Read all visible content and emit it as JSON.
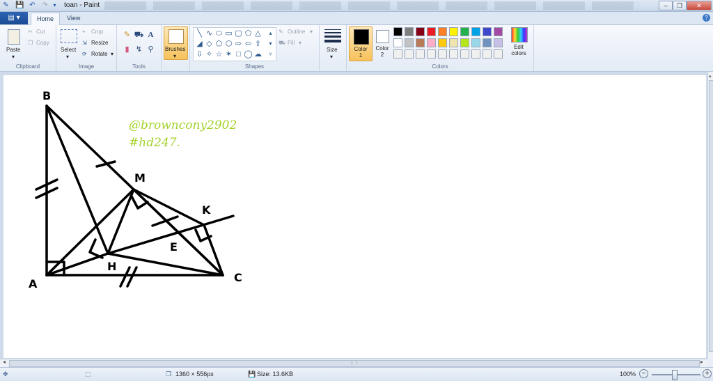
{
  "window": {
    "title": "toan - Paint",
    "minimize_glyph": "–",
    "restore_glyph": "❐",
    "close_glyph": "✕"
  },
  "tabs": {
    "file_menu": "▤ ▾",
    "home": "Home",
    "view": "View"
  },
  "help": "?",
  "ribbon": {
    "clipboard": {
      "label": "Clipboard",
      "paste": "Paste",
      "cut": "Cut",
      "copy": "Copy"
    },
    "image": {
      "label": "Image",
      "select": "Select",
      "crop": "Crop",
      "resize": "Resize",
      "rotate": "Rotate"
    },
    "tools": {
      "label": "Tools"
    },
    "brushes": {
      "label": "Brushes"
    },
    "shapes": {
      "label": "Shapes",
      "outline": "Outline",
      "fill": "Fill"
    },
    "size": {
      "label": "Size"
    },
    "colors": {
      "label": "Colors",
      "color1_label": "Color\n1",
      "color2_label": "Color\n2",
      "edit_colors": "Edit\ncolors",
      "color1_value": "#000000",
      "color2_value": "#ffffff",
      "palette_row1": [
        "#000000",
        "#7f7f7f",
        "#880015",
        "#ed1c24",
        "#ff7f27",
        "#fff200",
        "#22b14c",
        "#00a2e8",
        "#3f48cc",
        "#a349a4"
      ],
      "palette_row2": [
        "#ffffff",
        "#c3c3c3",
        "#b97a57",
        "#ffaec9",
        "#ffc90e",
        "#efe4b0",
        "#b5e61d",
        "#99d9ea",
        "#7092be",
        "#c8bfe7"
      ],
      "palette_row3": [
        "#f0f0f0",
        "#f0f0f0",
        "#f0f0f0",
        "#f0f0f0",
        "#f0f0f0",
        "#f0f0f0",
        "#f0f0f0",
        "#f0f0f0",
        "#f0f0f0",
        "#f0f0f0"
      ]
    }
  },
  "drawing": {
    "labels": {
      "B": "B",
      "M": "M",
      "K": "K",
      "E": "E",
      "H": "H",
      "A": "A",
      "C": "C"
    },
    "watermark_line1": "@browncony2902",
    "watermark_line2": "#hd247.",
    "watermark_color": "#a4d22c"
  },
  "statusbar": {
    "dimensions": "1360 × 556px",
    "size": "Size: 13.6KB",
    "zoom": "100%"
  }
}
